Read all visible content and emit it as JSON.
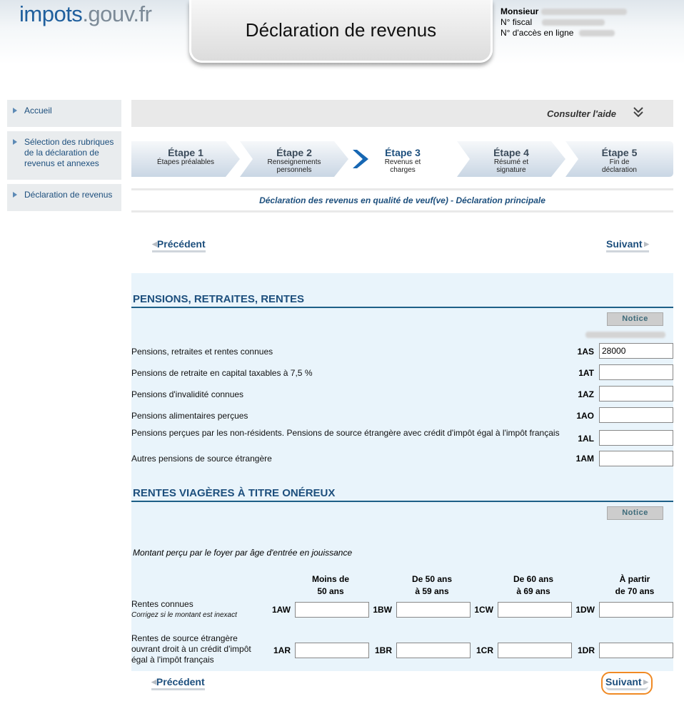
{
  "header": {
    "logo_part1": "impots",
    "logo_part2": ".gouv.fr",
    "title": "Déclaration de revenus",
    "user_civility": "Monsieur",
    "fiscal_label": "N° fiscal",
    "access_label": "N° d'accès en ligne"
  },
  "sidebar": {
    "items": [
      {
        "label": "Accueil"
      },
      {
        "label": "Sélection des rubriques de la déclaration de revenus et annexes"
      },
      {
        "label": "Déclaration de revenus"
      }
    ]
  },
  "help": {
    "label": "Consulter l'aide"
  },
  "steps": [
    {
      "title": "Étape 1",
      "sub": "Étapes préalables"
    },
    {
      "title": "Étape 2",
      "sub": "Renseignements personnels"
    },
    {
      "title": "Étape 3",
      "sub": "Revenus et charges"
    },
    {
      "title": "Étape 4",
      "sub": "Résumé et signature"
    },
    {
      "title": "Étape 5",
      "sub": "Fin de déclaration"
    }
  ],
  "declaration_label": "Déclaration des revenus en qualité de veuf(ve) - Déclaration principale",
  "nav": {
    "previous": "Précédent",
    "next": "Suivant"
  },
  "pensions": {
    "title": "PENSIONS, RETRAITES, RENTES",
    "notice": "Notice",
    "rows": [
      {
        "label": "Pensions, retraites et rentes connues",
        "code": "1AS",
        "value": "28000"
      },
      {
        "label": "Pensions de retraite en capital taxables à 7,5 %",
        "code": "1AT",
        "value": ""
      },
      {
        "label": "Pensions d'invalidité connues",
        "code": "1AZ",
        "value": ""
      },
      {
        "label": "Pensions alimentaires perçues",
        "code": "1AO",
        "value": ""
      },
      {
        "label": "Pensions perçues par les non-résidents. Pensions de source étrangère avec crédit d'impôt égal à l'impôt français",
        "code": "1AL",
        "value": ""
      },
      {
        "label": "Autres pensions de source étrangère",
        "code": "1AM",
        "value": ""
      }
    ]
  },
  "rentes": {
    "title": "RENTES VIAGÈRES À TITRE ONÉREUX",
    "notice": "Notice",
    "intro": "Montant perçu par le foyer par âge d'entrée en jouissance",
    "columns": [
      {
        "line1": "Moins de",
        "line2": "50 ans"
      },
      {
        "line1": "De 50 ans",
        "line2": "à 59 ans"
      },
      {
        "line1": "De 60 ans",
        "line2": "à 69 ans"
      },
      {
        "line1": "À partir",
        "line2": "de 70 ans"
      }
    ],
    "row1": {
      "label": "Rentes connues",
      "note": "Corrigez si le montant est inexact",
      "codes": [
        "1AW",
        "1BW",
        "1CW",
        "1DW"
      ]
    },
    "row2": {
      "label": "Rentes de source étrangère ouvrant droit à un crédit d'impôt égal à l'impôt français",
      "codes": [
        "1AR",
        "1BR",
        "1CR",
        "1DR"
      ]
    }
  }
}
